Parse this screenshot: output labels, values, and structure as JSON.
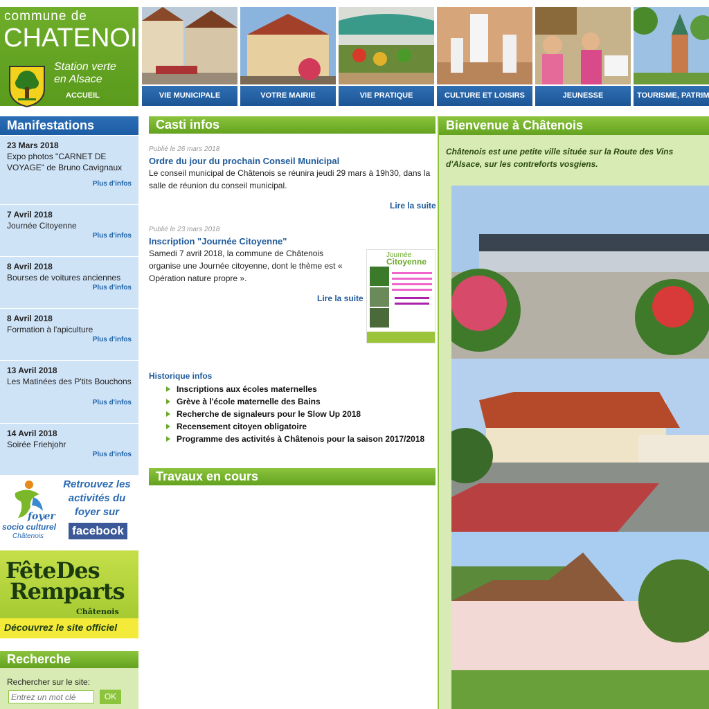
{
  "header": {
    "logo_line1": "commune de",
    "logo_line2": "CHATENOIS",
    "logo_tag1": "Station verte",
    "logo_tag2": "en Alsace",
    "accueil": "ACCUEIL"
  },
  "nav": [
    {
      "label": "VIE MUNICIPALE"
    },
    {
      "label": "VOTRE MAIRIE"
    },
    {
      "label": "VIE PRATIQUE"
    },
    {
      "label": "CULTURE ET LOISIRS"
    },
    {
      "label": "JEUNESSE"
    },
    {
      "label": "TOURISME, PATRIM"
    }
  ],
  "manifestations": {
    "title": "Manifestations",
    "more_label": "Plus d'infos",
    "events": [
      {
        "date": "23 Mars 2018",
        "desc": "Expo photos \"CARNET DE VOYAGE\" de Bruno Cavignaux"
      },
      {
        "date": "7 Avril 2018",
        "desc": "Journée Citoyenne"
      },
      {
        "date": "8 Avril 2018",
        "desc": "Bourses de voitures anciennes"
      },
      {
        "date": "8 Avril 2018",
        "desc": "Formation à l'apiculture"
      },
      {
        "date": "13 Avril 2018",
        "desc": "Les Matinées des P'tits Bouchons"
      },
      {
        "date": "14 Avril 2018",
        "desc": "Soirée Friehjohr"
      }
    ]
  },
  "foyer": {
    "text": "Retrouvez les activités du foyer sur",
    "facebook": "facebook",
    "logo_line1": "foyer",
    "logo_line2": "socio culturel",
    "logo_line3": "Châtenois"
  },
  "fete": {
    "line1": "FêteDes",
    "line2": "Remparts",
    "line3": "Châtenois",
    "cta": "Découvrez le site officiel"
  },
  "search": {
    "title": "Recherche",
    "label": "Rechercher sur le site:",
    "placeholder": "Entrez un mot clé",
    "button": "OK"
  },
  "casti": {
    "title": "Casti infos",
    "read_more": "Lire la suite",
    "news": [
      {
        "published": "Publié le 26 mars 2018",
        "title": "Ordre du jour du prochain Conseil Municipal",
        "body": "Le conseil municipal de Châtenois se réunira jeudi 29 mars à 19h30, dans la salle de réunion du conseil municipal."
      },
      {
        "published": "Publié le 23 mars 2018",
        "title": "Inscription \"Journée Citoyenne\"",
        "body": "Samedi 7 avril 2018, la commune de Châtenois organise une Journée citoyenne, dont le thème est « Opération nature propre »."
      }
    ],
    "poster_title1": "Journée",
    "poster_title2": "Citoyenne"
  },
  "history": {
    "title": "Historique infos",
    "items": [
      "Inscriptions aux écoles maternelles",
      "Grève à l'école maternelle des Bains",
      "Recherche de signaleurs pour le Slow Up 2018",
      "Recensement citoyen obligatoire",
      "Programme des activités à Châtenois pour la saison 2017/2018"
    ]
  },
  "travaux": {
    "title": "Travaux en cours"
  },
  "welcome": {
    "title": "Bienvenue à Châtenois",
    "text": "Châtenois est une petite ville située sur la Route des Vins d'Alsace, sur les contreforts vosgiens."
  }
}
